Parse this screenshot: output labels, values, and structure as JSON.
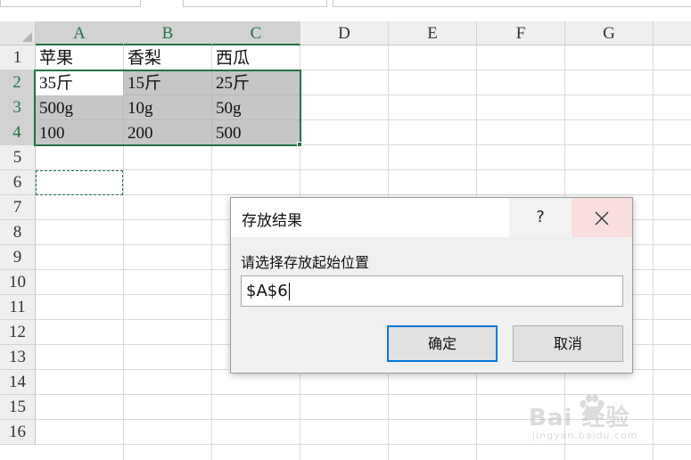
{
  "sheet": {
    "columns": [
      "A",
      "B",
      "C",
      "D",
      "E",
      "F",
      "G"
    ],
    "rows": [
      "1",
      "2",
      "3",
      "4",
      "5",
      "6",
      "7",
      "8",
      "9",
      "10",
      "11",
      "12",
      "13",
      "14",
      "15",
      "16"
    ],
    "cells": {
      "A1": "苹果",
      "B1": "香梨",
      "C1": "西瓜",
      "A2": "35斤",
      "B2": "15斤",
      "C2": "25斤",
      "A3": "500g",
      "B3": "10g",
      "C3": "50g",
      "A4": "100",
      "B4": "200",
      "C4": "500"
    },
    "selected_range": "A2:C4",
    "marquee_cell": "A6",
    "colors": {
      "selection_accent": "#217346",
      "selection_fill": "#c6c6c6"
    }
  },
  "dialog": {
    "title": "存放结果",
    "help_label": "?",
    "close_label": "✕",
    "prompt_label": "请选择存放起始位置",
    "input_value": "$A$6",
    "ok_label": "确定",
    "cancel_label": "取消",
    "accent": "#0078d7"
  },
  "watermark": {
    "brand": "Bai  经验",
    "url": "jingyan.baidu.com"
  }
}
